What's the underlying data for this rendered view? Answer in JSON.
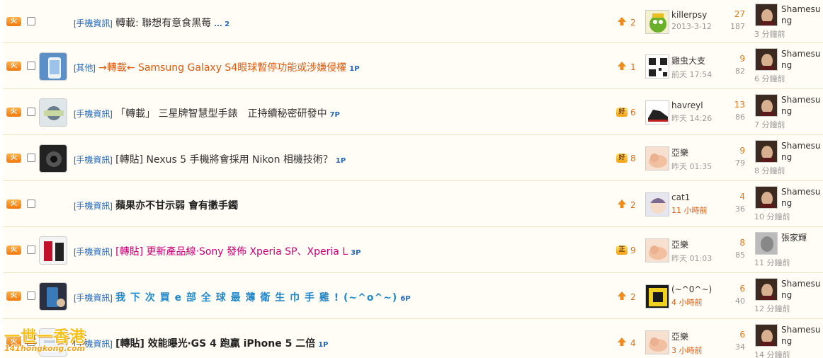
{
  "hot_badge": "火",
  "rows": [
    {
      "has_thumb": false,
      "category": "[手機資訊]",
      "title": "轉載: 聯想有意食黑莓",
      "pages": "... 2",
      "title_style": "plain",
      "vote_type": "up",
      "vote_badge": "",
      "vote_count": "2",
      "author": "killerpsy",
      "date": "2013-3-12",
      "date_hot": false,
      "replies": "27",
      "views": "187",
      "last_name": "Shamesung",
      "last_time": "3 分鐘前",
      "avatar_icon": "angry-bird-avatar-icon"
    },
    {
      "has_thumb": true,
      "category": "[其他]",
      "title": "→轉載← Samsung Galaxy S4眼球暫停功能或涉嫌侵權",
      "pages": "1P",
      "title_style": "orange",
      "vote_type": "up",
      "vote_badge": "",
      "vote_count": "1",
      "author": "雞虫大支",
      "date": "前天 17:54",
      "date_hot": false,
      "replies": "9",
      "views": "82",
      "last_name": "Shamesung",
      "last_time": "6 分鐘前",
      "avatar_icon": "qr-avatar-icon"
    },
    {
      "has_thumb": true,
      "category": "[手機資訊]",
      "title": "「轉載」 三星牌智慧型手錶　正持續秘密研發中",
      "pages": "7P",
      "title_style": "plain",
      "vote_type": "badge",
      "vote_badge": "好",
      "vote_count": "6",
      "author": "havreyl",
      "date": "昨天 14:26",
      "date_hot": false,
      "replies": "13",
      "views": "86",
      "last_name": "Shamesung",
      "last_time": "7 分鐘前",
      "avatar_icon": "sneaker-avatar-icon"
    },
    {
      "has_thumb": true,
      "category": "[手機資訊]",
      "title": "[轉貼] Nexus 5 手機將會採用 Nikon 相機技術？",
      "pages": "1P",
      "title_style": "plain",
      "vote_type": "badge",
      "vote_badge": "好",
      "vote_count": "8",
      "author": "亞樂",
      "date": "昨天 01:35",
      "date_hot": false,
      "replies": "9",
      "views": "79",
      "last_name": "Shamesung",
      "last_time": "8 分鐘前",
      "avatar_icon": "baby-avatar-icon"
    },
    {
      "has_thumb": false,
      "category": "[手機資訊]",
      "title": "蘋果亦不甘示弱 會有擻手鐲",
      "pages": "",
      "title_style": "bold",
      "vote_type": "up",
      "vote_badge": "",
      "vote_count": "2",
      "author": "cat1",
      "date": "11 小時前",
      "date_hot": true,
      "replies": "4",
      "views": "36",
      "last_name": "Shamesung",
      "last_time": "10 分鐘前",
      "avatar_icon": "anime-avatar-icon"
    },
    {
      "has_thumb": true,
      "category": "[手機資訊]",
      "title": "[轉貼] 更新產品線‧Sony 發佈 Xperia SP、Xperia L",
      "pages": "3P",
      "title_style": "magenta",
      "vote_type": "badge",
      "vote_badge": "正",
      "vote_count": "9",
      "author": "亞樂",
      "date": "昨天 01:03",
      "date_hot": false,
      "replies": "8",
      "views": "85",
      "last_name": "張家輝",
      "last_time": "11 分鐘前",
      "avatar_icon": "baby-avatar-icon"
    },
    {
      "has_thumb": true,
      "category": "[手機資訊]",
      "title": "我 下 次 買 e 部 全 球 最 薄 衛 生 巾 手 雞 ! (~^o^~)",
      "pages": "6P",
      "title_style": "blue",
      "vote_type": "up",
      "vote_badge": "",
      "vote_count": "2",
      "author": "(~^0^~)",
      "date": "4 小時前",
      "date_hot": true,
      "replies": "6",
      "views": "40",
      "last_name": "Shamesung",
      "last_time": "12 分鐘前",
      "avatar_icon": "sign-avatar-icon"
    },
    {
      "has_thumb": true,
      "category": "[手機資訊]",
      "title": "[轉貼] 效能曝光‧GS 4 跑贏 iPhone 5 二倍",
      "pages": "1P",
      "title_style": "bold",
      "vote_type": "up",
      "vote_badge": "",
      "vote_count": "4",
      "author": "亞樂",
      "date": "3 小時前",
      "date_hot": true,
      "replies": "6",
      "views": "34",
      "last_name": "Shamesung",
      "last_time": "14 分鐘前",
      "avatar_icon": "baby-avatar-icon"
    }
  ],
  "logo": {
    "line1": "一世一香港",
    "line2": "141hongkong.com"
  }
}
